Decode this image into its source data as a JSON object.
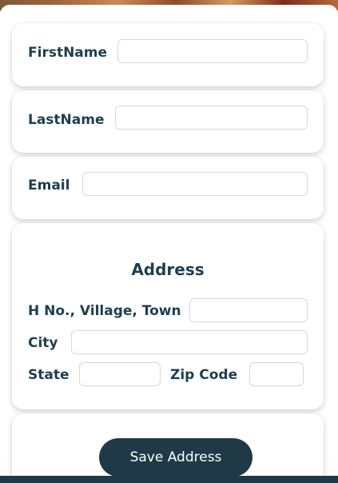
{
  "form": {
    "first_name": {
      "label": "FirstName",
      "value": "",
      "placeholder": ""
    },
    "last_name": {
      "label": "LastName",
      "value": "",
      "placeholder": ""
    },
    "email": {
      "label": "Email",
      "value": "",
      "placeholder": ""
    },
    "address": {
      "title": "Address",
      "house": {
        "label": "H No., Village, Town",
        "value": "",
        "placeholder": ""
      },
      "city": {
        "label": "City",
        "value": "",
        "placeholder": ""
      },
      "state": {
        "label": "State",
        "value": "",
        "placeholder": ""
      },
      "zip": {
        "label": "Zip Code",
        "value": "",
        "placeholder": ""
      }
    },
    "save_label": "Save Address"
  },
  "colors": {
    "label_text": "#1e3f4f",
    "button_bg": "#1f3a46",
    "button_text": "#ffffff",
    "card_bg": "#ffffff",
    "field_border": "#d4d8db"
  }
}
